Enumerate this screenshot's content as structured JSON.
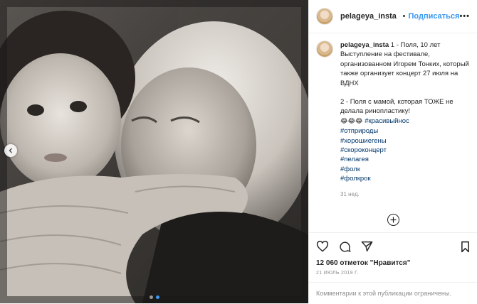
{
  "header": {
    "username": "pelageya_insta",
    "follow_label": "Подписаться",
    "separator": "•",
    "more_label": "•••"
  },
  "caption": {
    "username": "pelageya_insta",
    "line1": "1 - Поля, 10 лет Выступление на фестивале, организованном Игорем Тонких, который также организует концерт 27 июля на ВДНХ",
    "line2": "2 - Поля с мамой, которая ТОЖЕ не делала ринопластику!",
    "emojis": "😂😂😂",
    "hashtags": [
      "#красивыйнос",
      "#отприроды",
      "#хорошиегены",
      "#скороконцерт",
      "#пелагея",
      "#фолк",
      "#фолкрок"
    ],
    "time": "31 нед."
  },
  "likes_text": "12 060 отметок \"Нравится\"",
  "date_text": "21 ИЮЛЬ 2019 Г.",
  "comments_disabled": "Комментарии к этой публикации ограничены.",
  "icons": [
    "chevron-left-icon",
    "plus-circle-icon",
    "heart-icon",
    "comment-icon",
    "share-icon",
    "bookmark-icon",
    "verified-icon"
  ],
  "carousel": {
    "slide_count": 2,
    "active_slide": 2
  },
  "colors": {
    "accent": "#3897f0",
    "muted": "#8e8e8e",
    "hashtag": "#00376b"
  }
}
